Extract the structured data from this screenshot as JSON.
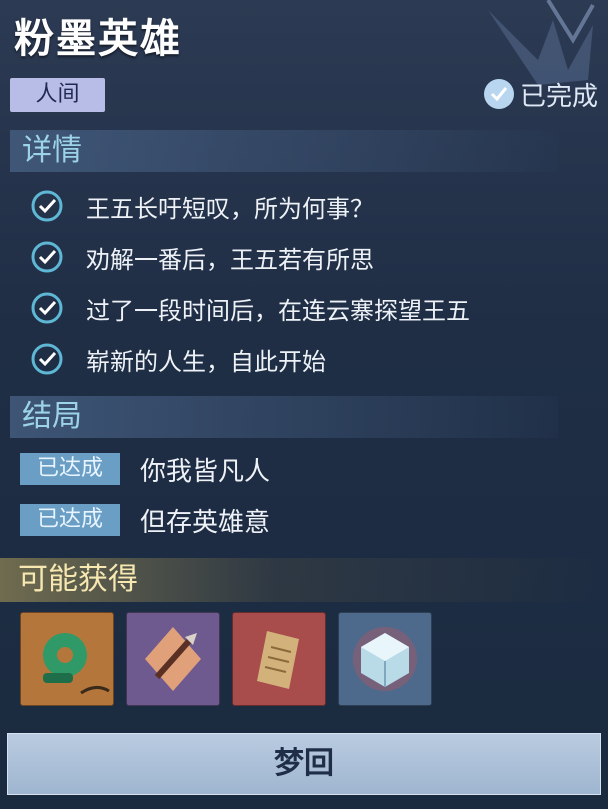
{
  "quest": {
    "title": "粉墨英雄",
    "realm_tag": "人间",
    "status_label": "已完成"
  },
  "details": {
    "heading": "详情",
    "tasks": [
      {
        "text": "王五长吁短叹，所为何事？"
      },
      {
        "text": "劝解一番后，王五若有所思"
      },
      {
        "text": "过了一段时间后，在连云寨探望王五"
      },
      {
        "text": "崭新的人生，自此开始"
      }
    ]
  },
  "ending": {
    "heading": "结局",
    "items": [
      {
        "badge": "已达成",
        "text": "你我皆凡人"
      },
      {
        "badge": "已达成",
        "text": "但存英雄意"
      }
    ]
  },
  "rewards": {
    "heading": "可能获得",
    "items": [
      {
        "icon": "jade-pendant-icon",
        "bg": "#b5763c"
      },
      {
        "icon": "dagger-icon",
        "bg": "#6e5a8e"
      },
      {
        "icon": "paper-document-icon",
        "bg": "#a84c4c"
      },
      {
        "icon": "crystal-cube-icon",
        "bg": "#4d6a8c"
      }
    ]
  },
  "actions": {
    "dream_button": "梦回"
  },
  "colors": {
    "accent_check": "#5fb7d6",
    "tag_bg": "#b8bde8",
    "badge_bg": "#6a9ec4"
  }
}
